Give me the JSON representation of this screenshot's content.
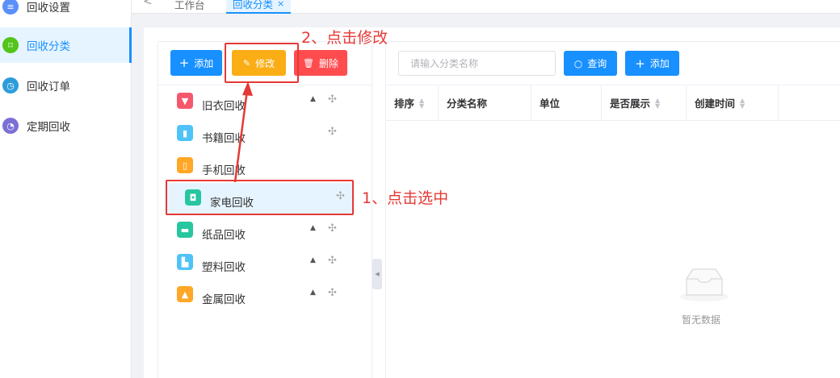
{
  "sidebar": {
    "items": [
      {
        "label": "回收设置",
        "icon": "menu-icon",
        "color": "#5b8ff9"
      },
      {
        "label": "回收分类",
        "icon": "bookmark-icon",
        "color": "#52c41a",
        "active": true
      },
      {
        "label": "回收订单",
        "icon": "clock-icon",
        "color": "#2d9cdb"
      },
      {
        "label": "定期回收",
        "icon": "timer-icon",
        "color": "#7b6fd6"
      }
    ]
  },
  "tabs": {
    "back": "<",
    "items": [
      {
        "label": "工作台"
      },
      {
        "label": "回收分类",
        "close": "×",
        "active": true
      }
    ]
  },
  "tree_toolbar": {
    "add_label": "添加",
    "edit_label": "修改",
    "delete_label": "删除"
  },
  "tree": {
    "items": [
      {
        "label": "旧衣回收",
        "icon": "clothes-icon",
        "color": "#f5576c",
        "sortable_up": true
      },
      {
        "label": "书籍回收",
        "icon": "book-icon",
        "color": "#4fc3f7",
        "sortable_up": false
      },
      {
        "label": "手机回收",
        "icon": "phone-icon",
        "color": "#ffa726",
        "sortable_up": false
      },
      {
        "label": "家电回收",
        "icon": "appliance-icon",
        "color": "#26c6a0",
        "sortable_up": false,
        "selected": true
      },
      {
        "label": "纸品回收",
        "icon": "paper-icon",
        "color": "#26c6a0",
        "sortable_up": true
      },
      {
        "label": "塑料回收",
        "icon": "plastic-icon",
        "color": "#4fc3f7",
        "sortable_up": true
      },
      {
        "label": "金属回收",
        "icon": "metal-icon",
        "color": "#ffa726",
        "sortable_up": true
      }
    ],
    "up_glyph": "▲",
    "move_glyph": "✣"
  },
  "search": {
    "placeholder": "请输入分类名称",
    "query_label": "查询",
    "add_label": "添加"
  },
  "table": {
    "columns": [
      "排序",
      "分类名称",
      "单位",
      "是否展示",
      "创建时间"
    ],
    "empty_text": "暂无数据"
  },
  "annotations": {
    "step1": "1、点击选中",
    "step2": "2、点击修改",
    "color": "#e53935"
  }
}
